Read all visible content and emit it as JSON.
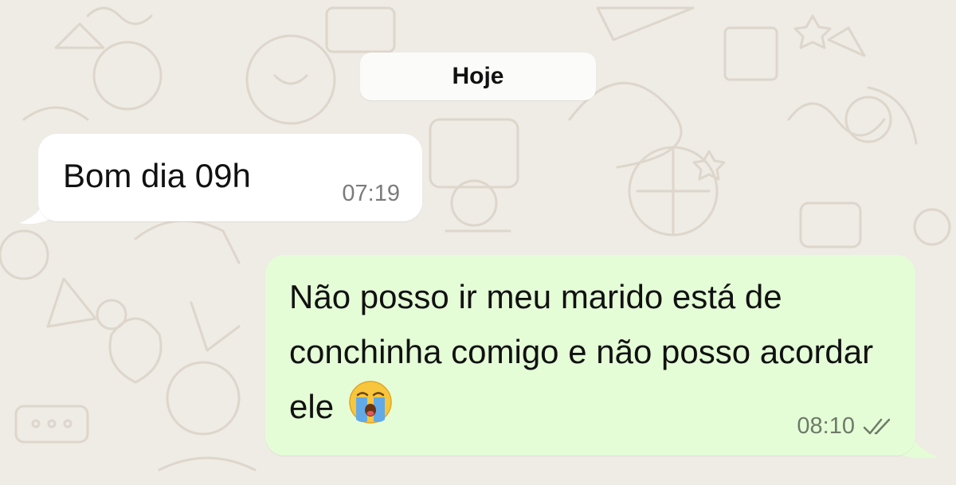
{
  "chat": {
    "date_separator": "Hoje",
    "messages": [
      {
        "direction": "incoming",
        "text": "Bom dia 09h",
        "time": "07:19"
      },
      {
        "direction": "outgoing",
        "text": "Não posso ir meu marido está de conchinha comigo e não posso acordar ele",
        "emoji": "loudly-crying-face",
        "time": "08:10",
        "status": "read-check-icon"
      }
    ]
  },
  "colors": {
    "background": "#efebe5",
    "incoming_bubble": "#ffffff",
    "outgoing_bubble": "#e4fdd7",
    "time_text": "#7b7b7b"
  }
}
